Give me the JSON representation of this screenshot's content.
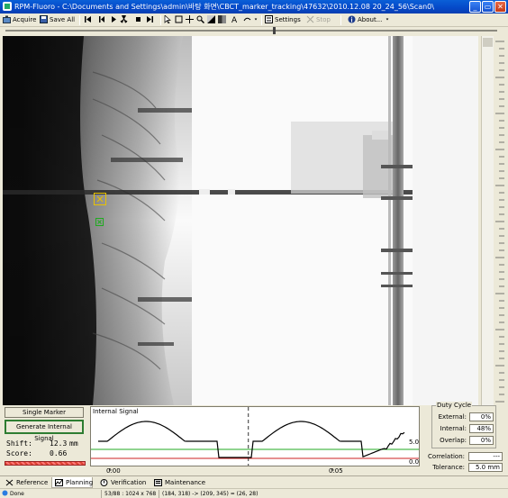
{
  "window": {
    "title": "RPM-Fluoro - C:\\Documents and Settings\\admin\\바탕 화면\\CBCT_marker_tracking\\47632\\2010.12.08 20_24_56\\Scan0\\",
    "minimize": "_",
    "restore": "▭",
    "close": "✕"
  },
  "toolbar": {
    "acquire": "Acquire",
    "save_all": "Save All",
    "settings": "Settings",
    "stop": "Stop",
    "about": "About..."
  },
  "image": {
    "marker_box_icon": "target-box-icon",
    "marker_green_icon": "target-cross-icon"
  },
  "marker_panel": {
    "single_marker": "Single Marker",
    "generate_signal": "Generate Internal Signal",
    "shift_label": "Shift:",
    "shift_value": "12.3",
    "shift_unit": "mm",
    "score_label": "Score:",
    "score_value": "0.66"
  },
  "signal": {
    "caption": "Internal Signal",
    "ref_value": "5.0",
    "ref_value2": "0.0",
    "time_start": "0:00",
    "time_mid": "0:05",
    "signal_color": "#000000",
    "threshold_color": "#22aa22",
    "baseline_color": "#cc2222",
    "cursor_fraction": 0.48
  },
  "duty_cycle": {
    "legend": "Duty Cycle",
    "external_label": "External:",
    "external_value": "0%",
    "internal_label": "Internal:",
    "internal_value": "48%",
    "overlap_label": "Overlap:",
    "overlap_value": "0%"
  },
  "correlation": {
    "label": "Correlation:",
    "value": "---"
  },
  "tolerance": {
    "label": "Tolerance:",
    "value": "5.0",
    "unit": "mm"
  },
  "tabs": [
    {
      "label": "Reference",
      "active": false
    },
    {
      "label": "Planning",
      "active": true
    },
    {
      "label": "Verification",
      "active": false
    },
    {
      "label": "Maintenance",
      "active": false
    }
  ],
  "status": {
    "state": "Done",
    "frame": "53/88 : 1024 x 768",
    "coords": "(184, 318) -> (209, 345) = (26, 28)"
  }
}
